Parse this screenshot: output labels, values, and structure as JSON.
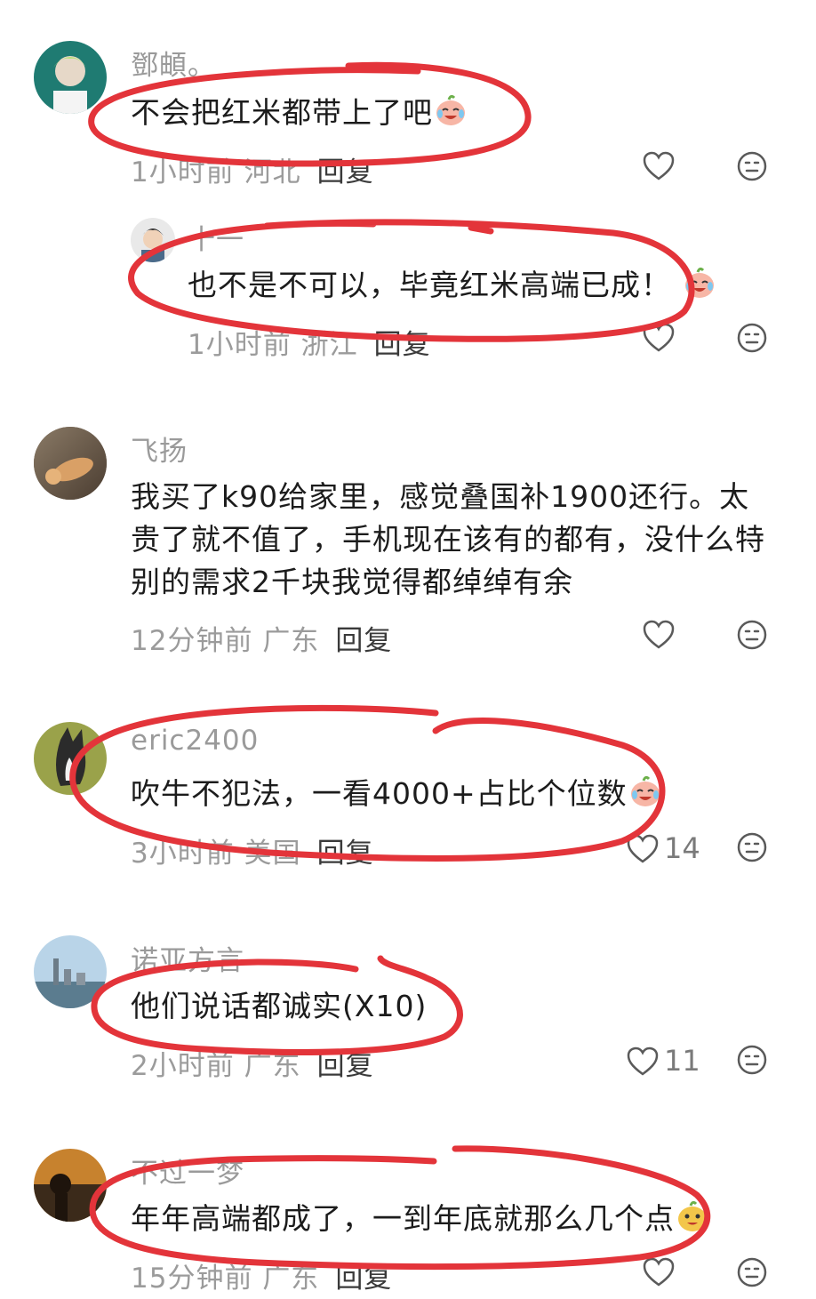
{
  "comments": [
    {
      "username": "鄧頔。",
      "text": "不会把红米都带上了吧",
      "emoji": "crying-laughing-peach-emoji",
      "time": "1小时前",
      "location": "河北",
      "reply": "回复",
      "likes": ""
    },
    {
      "username": "十一",
      "text": "也不是不可以，毕竟红米高端已成！",
      "emoji": "crying-laughing-peach-emoji",
      "time": "1小时前",
      "location": "浙江",
      "reply": "回复",
      "likes": ""
    },
    {
      "username": "飞扬",
      "text": "我买了k90给家里，感觉叠国补1900还行。太贵了就不值了，手机现在该有的都有，没什么特别的需求2千块我觉得都绰绰有余",
      "time": "12分钟前",
      "location": "广东",
      "reply": "回复",
      "likes": ""
    },
    {
      "username": "eric2400",
      "text": "吹牛不犯法，一看4000+占比个位数",
      "emoji": "crying-laughing-peach-emoji",
      "time": "3小时前",
      "location": "美国",
      "reply": "回复",
      "likes": "14"
    },
    {
      "username": "诺亚方言",
      "text": "他们说话都诚实(X10)",
      "time": "2小时前",
      "location": "广东",
      "reply": "回复",
      "likes": "11"
    },
    {
      "username": "不过一梦",
      "text": "年年高端都成了，一到年底就那么几个点",
      "emoji": "grinning-mango-emoji",
      "time": "15分钟前",
      "location": "广东",
      "reply": "回复",
      "likes": ""
    }
  ],
  "colors": {
    "annotation_red": "#e3343a",
    "meta_gray": "#9b9b9b"
  }
}
